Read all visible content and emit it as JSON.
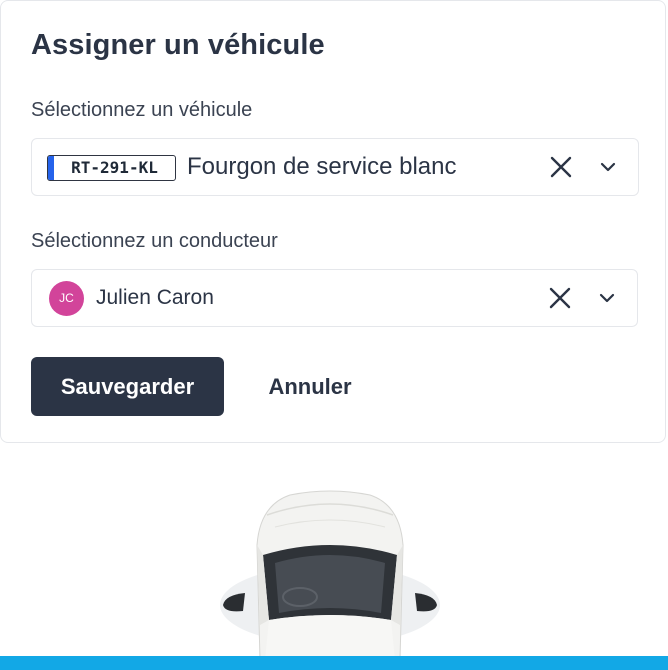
{
  "dialog": {
    "title": "Assigner un véhicule"
  },
  "vehicle_field": {
    "label": "Sélectionnez un véhicule",
    "plate": "RT-291-KL",
    "value": "Fourgon de service blanc"
  },
  "driver_field": {
    "label": "Sélectionnez un conducteur",
    "initials": "JC",
    "value": "Julien Caron",
    "avatar_color": "#d2449a"
  },
  "actions": {
    "save_label": "Sauvegarder",
    "cancel_label": "Annuler"
  },
  "colors": {
    "primary": "#2b3445",
    "accent_bar": "#12a8e6",
    "plate_stripe": "#2563eb"
  },
  "icons": {
    "clear": "close-icon",
    "dropdown": "chevron-down-icon"
  }
}
